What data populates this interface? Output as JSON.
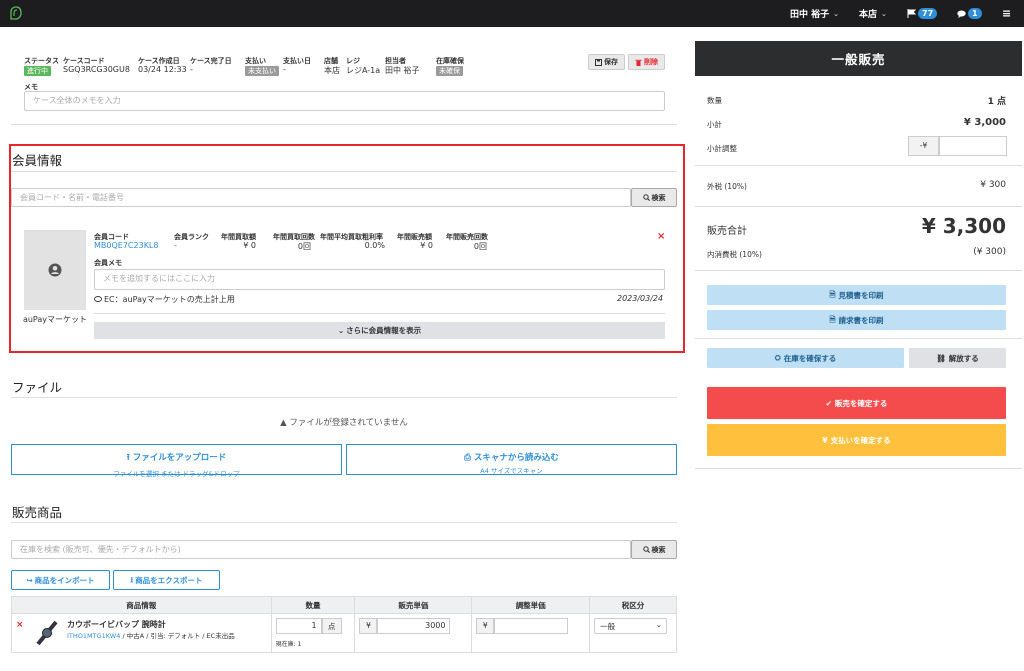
{
  "topbar": {
    "user": "田中 裕子",
    "store": "本店",
    "flag_count": "77",
    "chat_count": "1"
  },
  "case": {
    "status_label": "ステータス",
    "status_value": "進行中",
    "code_label": "ケースコード",
    "code_value": "SGQ3RCG30GU8",
    "created_label": "ケース作成日",
    "created_value": "03/24 12:33",
    "completed_label": "ケース完了日",
    "completed_value": "-",
    "payment_label": "支払い",
    "payment_value": "未支払い",
    "payment_date_label": "支払い日",
    "payment_date_value": "-",
    "store_label": "店舗",
    "store_value": "本店",
    "register_label": "レジ",
    "register_value": "レジA-1a",
    "staff_label": "担当者",
    "staff_value": "田中 裕子",
    "stock_label": "在庫確保",
    "stock_value": "未確保",
    "save_label": "保存",
    "delete_label": "削除",
    "memo_label": "メモ",
    "memo_placeholder": "ケース全体のメモを入力"
  },
  "member": {
    "title": "会員情報",
    "search_placeholder": "会員コード・名前・電話番号",
    "search_button": "検索",
    "name": "auPayマーケット",
    "code_label": "会員コード",
    "code_value": "MB0QE7C23KL8",
    "rank_label": "会員ランク",
    "rank_value": "-",
    "annual_buy_label": "年間買取額",
    "annual_buy_value": "¥ 0",
    "annual_buy_count_label": "年間買取回数",
    "annual_buy_count_value": "0回",
    "annual_margin_label": "年間平均買取粗利率",
    "annual_margin_value": "0.0%",
    "annual_sales_label": "年間販売額",
    "annual_sales_value": "¥ 0",
    "annual_sales_count_label": "年間販売回数",
    "annual_sales_count_value": "0回",
    "memo_label": "会員メモ",
    "memo_placeholder": "メモを追加するにはここに入力",
    "note": "EC：auPayマーケットの売上計上用",
    "note_date": "2023/03/24",
    "more_button": "さらに会員情報を表示"
  },
  "files": {
    "title": "ファイル",
    "empty": "ファイルが登録されていません",
    "upload_title": "ファイルをアップロード",
    "upload_sub": "ファイルを選択 または ドラッグ&ドロップ",
    "scan_title": "スキャナから読み込む",
    "scan_sub": "A4 サイズでスキャン"
  },
  "products": {
    "title": "販売商品",
    "search_placeholder": "在庫を検索 (販売可、優先・デフォルトから)",
    "search_button": "検索",
    "import_button": "商品をインポート",
    "export_button": "商品をエクスポート",
    "columns": [
      "商品情報",
      "数量",
      "販売単価",
      "調整単価",
      "税区分"
    ],
    "rows": [
      {
        "name": "カウボーイビバップ 腕時計",
        "code": "ITHO1MTG1KW4",
        "meta": "/ 中古A / 引当: デフォルト / EC未出品",
        "qty": "1",
        "unit": "点",
        "stock": "現在庫: 1",
        "currency": "¥",
        "price": "3000",
        "adj_currency": "¥",
        "adj_price": "",
        "tax": "一般"
      }
    ]
  },
  "summary": {
    "title": "一般販売",
    "qty_label": "数量",
    "qty_value": "1 点",
    "subtotal_label": "小計",
    "subtotal_value": "¥ 3,000",
    "adjust_label": "小計調整",
    "adjust_prefix": "-¥",
    "tax_label": "外税 (10%)",
    "tax_value": "¥ 300",
    "total_label": "販売合計",
    "total_value": "¥ 3,300",
    "inner_tax_label": "内消費税 (10%)",
    "inner_tax_value": "(¥ 300)",
    "print_estimate": "見積書を印刷",
    "print_invoice": "請求書を印刷",
    "reserve_stock": "在庫を確保する",
    "release": "解放する",
    "confirm_sale": "販売を確定する",
    "confirm_payment": "支払いを確定する"
  },
  "colors": {
    "accent": "#2f8fd8",
    "success": "#5cb85c",
    "danger": "#f44c4c",
    "warning": "#ffc13d",
    "dark": "#2b2d2f"
  }
}
